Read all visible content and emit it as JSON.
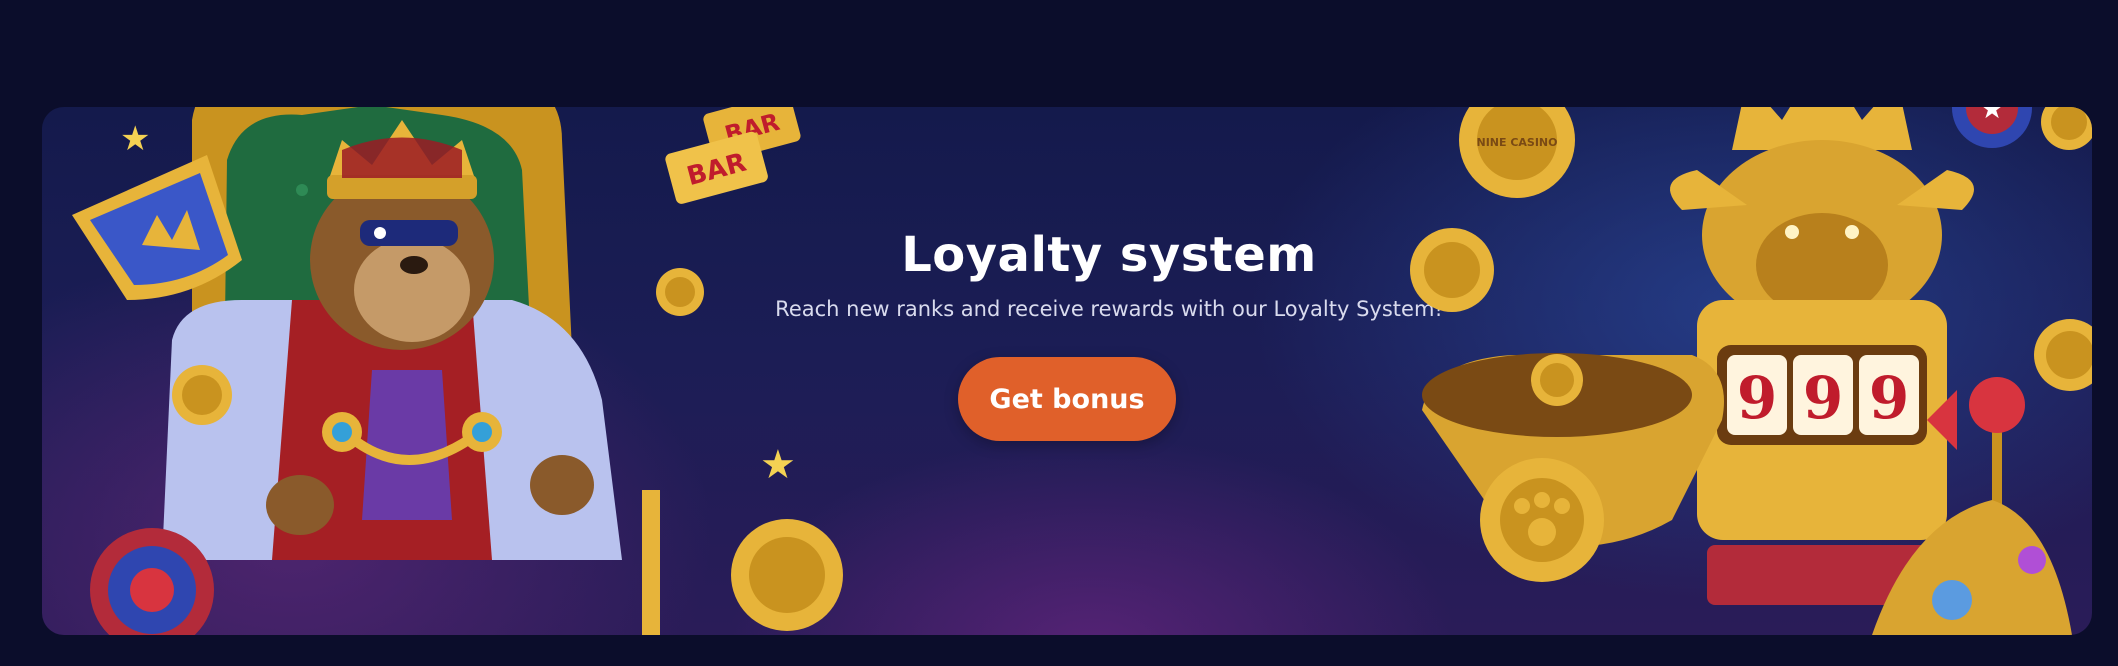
{
  "promo": {
    "title": "Loyalty system",
    "subtitle": "Reach new ranks and receive rewards with our Loyalty System!",
    "button_label": "Get bonus"
  },
  "art": {
    "slot_reels": [
      "9",
      "9",
      "9"
    ],
    "bar_signs": [
      "BAR",
      "BAR"
    ],
    "coin_text": "NINE CASINO"
  },
  "colors": {
    "page_background": "#0b0d2b",
    "button": "#e0602a",
    "gold": "#e7b43a",
    "throne_green": "#1f6b3f",
    "robe_red": "#a51f24",
    "fur": "#b9c2ee"
  }
}
